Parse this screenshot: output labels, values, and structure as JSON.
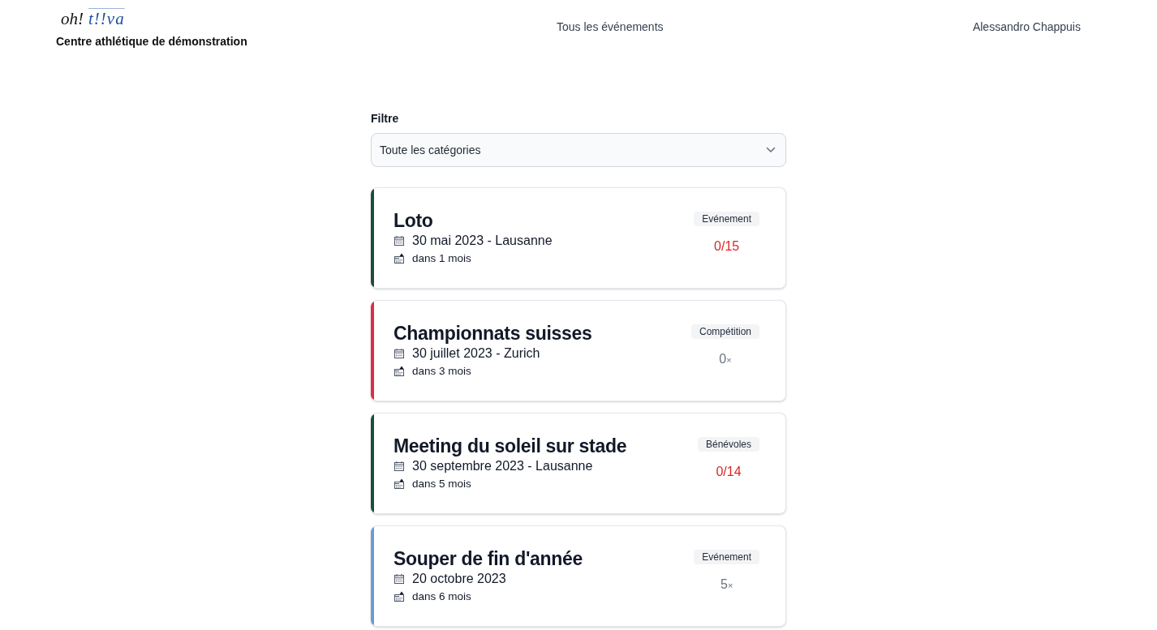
{
  "header": {
    "logo": {
      "part_1": "oh!",
      "part_2": "t!!va"
    },
    "organization": "Centre athlétique de démonstration",
    "nav": [
      {
        "label": "Tous les événements"
      }
    ],
    "user": "Alessandro Chappuis"
  },
  "filter": {
    "label": "Filtre",
    "select": {
      "value": "Toute les catégories"
    }
  },
  "events": [
    {
      "title": "Loto",
      "date": "30 mai 2023 - Lausanne",
      "relative": "dans 1 mois",
      "category": "Evénement",
      "color": "#1e4d3b",
      "count": {
        "kind": "quota",
        "value": "0/15"
      }
    },
    {
      "title": "Championnats suisses",
      "date": "30 juillet 2023 - Zurich",
      "relative": "dans 3 mois",
      "category": "Compétition",
      "color": "#dc2f45",
      "count": {
        "kind": "tally",
        "value": "0",
        "unit": "×"
      }
    },
    {
      "title": "Meeting du soleil sur stade",
      "date": "30 septembre 2023 - Lausanne",
      "relative": "dans 5 mois",
      "category": "Bénévoles",
      "color": "#1e4d3b",
      "count": {
        "kind": "quota",
        "value": "0/14"
      }
    },
    {
      "title": "Souper de fin d'année",
      "date": "20 octobre 2023",
      "relative": "dans 6 mois",
      "category": "Evénement",
      "color": "#6b9bd1",
      "count": {
        "kind": "tally",
        "value": "5",
        "unit": "×"
      }
    }
  ]
}
